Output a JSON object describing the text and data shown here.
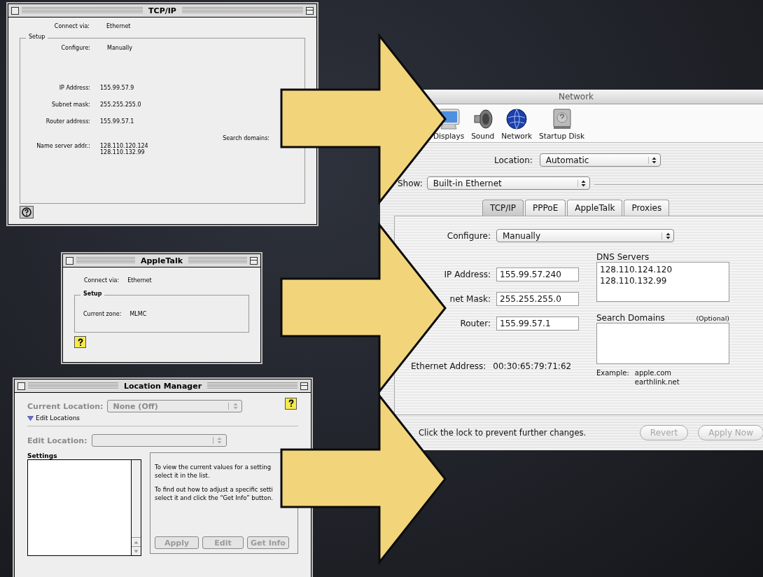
{
  "tcpip_window": {
    "title": "TCP/IP",
    "connect_via": {
      "label": "Connect via:",
      "value": "Ethernet"
    },
    "group_title": "Setup",
    "configure": {
      "label": "Configure:",
      "value": "Manually"
    },
    "fields": [
      {
        "label": "IP Address:",
        "value": "155.99.57.9"
      },
      {
        "label": "Subnet mask:",
        "value": "255.255.255.0"
      },
      {
        "label": "Router address:",
        "value": "155.99.57.1"
      }
    ],
    "search_domains_label": "Search domains:",
    "name_server": {
      "label": "Name server addr.:",
      "values": [
        "128.110.120.124",
        "128.110.132.99"
      ]
    }
  },
  "appletalk_window": {
    "title": "AppleTalk",
    "connect_via": {
      "label": "Connect via:",
      "value": "Ethernet"
    },
    "group_title": "Setup",
    "zone": {
      "label": "Current zone:",
      "value": "MLMC"
    }
  },
  "location_manager_window": {
    "title": "Location Manager",
    "current_location": {
      "label": "Current Location:",
      "value": "None (Off)",
      "disabled": true
    },
    "disclosure": {
      "label": "Edit Locations",
      "expanded": true
    },
    "edit_location": {
      "label": "Edit Location:",
      "disabled": true
    },
    "settings_label": "Settings",
    "info_paragraphs": [
      {
        "lines": [
          "To view the current values for a setting",
          "select it in the list."
        ]
      },
      {
        "lines": [
          "To find out how to adjust a specific setti",
          "select it and click the “Get Info” button."
        ]
      }
    ],
    "buttons": [
      {
        "label": "Apply",
        "disabled": true
      },
      {
        "label": "Edit",
        "disabled": true
      },
      {
        "label": "Get Info",
        "disabled": true
      }
    ]
  },
  "network_window": {
    "title": "Network",
    "toolbar": [
      {
        "label": "Displays",
        "kind": "display"
      },
      {
        "label": "Sound",
        "kind": "speaker"
      },
      {
        "label": "Network",
        "kind": "globe"
      },
      {
        "label": "Startup Disk",
        "kind": "disk"
      }
    ],
    "location": {
      "label": "Location:",
      "value": "Automatic"
    },
    "show": {
      "label": "Show:",
      "value": "Built-in Ethernet"
    },
    "tabs": [
      {
        "label": "TCP/IP",
        "selected": true
      },
      {
        "label": "PPPoE",
        "selected": false
      },
      {
        "label": "AppleTalk",
        "selected": false
      },
      {
        "label": "Proxies",
        "selected": false
      }
    ],
    "configure": {
      "label": "Configure:",
      "value": "Manually"
    },
    "fields": [
      {
        "label": "IP Address:",
        "value": "155.99.57.240"
      },
      {
        "label": "net Mask:",
        "value": "255.255.255.0"
      },
      {
        "label": "Router:",
        "value": "155.99.57.1"
      }
    ],
    "dns_label": "DNS Servers",
    "dns_servers": [
      "128.110.124.120",
      "128.110.132.99"
    ],
    "search_domains_label": "Search Domains",
    "search_domains_note": "(Optional)",
    "example_label": "Example:",
    "example_values": [
      "apple.com",
      "earthlink.net"
    ],
    "ethernet_address": {
      "label": "Ethernet Address:",
      "value": "00:30:65:79:71:62"
    },
    "lock_text": "Click the lock to prevent further changes.",
    "buttons": [
      {
        "label": "Revert",
        "disabled": true
      },
      {
        "label": "Apply Now",
        "disabled": true
      }
    ]
  }
}
